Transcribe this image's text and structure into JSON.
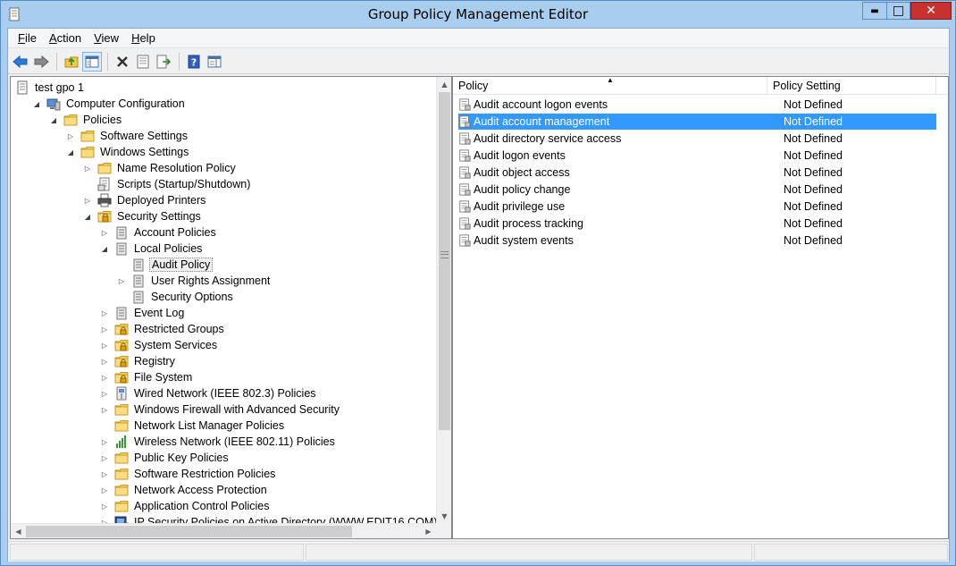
{
  "window": {
    "title": "Group Policy Management Editor",
    "minimize_glyph": "▬",
    "maximize_glyph": "□",
    "close_glyph": "✕"
  },
  "menu": {
    "items": [
      {
        "label": "File",
        "u": "F",
        "rest": "ile"
      },
      {
        "label": "Action",
        "u": "A",
        "rest": "ction"
      },
      {
        "label": "View",
        "u": "V",
        "rest": "iew"
      },
      {
        "label": "Help",
        "u": "H",
        "rest": "elp"
      }
    ]
  },
  "toolbar": {
    "buttons": [
      "back-icon",
      "forward-icon",
      "up-folder-icon",
      "show-hide-tree-icon",
      "delete-icon",
      "properties-icon",
      "export-list-icon",
      "help-icon",
      "show-hide-action-pane-icon"
    ]
  },
  "tree": {
    "items": [
      {
        "label": "test gpo 1",
        "indent": 0,
        "expander": "",
        "icon": "gpo-icon"
      },
      {
        "label": "Computer Configuration",
        "indent": 1,
        "expander": "open",
        "icon": "computer-icon"
      },
      {
        "label": "Policies",
        "indent": 2,
        "expander": "open",
        "icon": "folder-icon"
      },
      {
        "label": "Software Settings",
        "indent": 3,
        "expander": "closed",
        "icon": "folder-icon"
      },
      {
        "label": "Windows Settings",
        "indent": 3,
        "expander": "open",
        "icon": "folder-icon"
      },
      {
        "label": "Name Resolution Policy",
        "indent": 4,
        "expander": "closed",
        "icon": "folder-icon"
      },
      {
        "label": "Scripts (Startup/Shutdown)",
        "indent": 4,
        "expander": "",
        "icon": "script-icon"
      },
      {
        "label": "Deployed Printers",
        "indent": 4,
        "expander": "closed",
        "icon": "printer-icon"
      },
      {
        "label": "Security Settings",
        "indent": 4,
        "expander": "open",
        "icon": "security-icon"
      },
      {
        "label": "Account Policies",
        "indent": 5,
        "expander": "closed",
        "icon": "policy-book-icon"
      },
      {
        "label": "Local Policies",
        "indent": 5,
        "expander": "open",
        "icon": "policy-book-icon"
      },
      {
        "label": "Audit Policy",
        "indent": 6,
        "expander": "",
        "icon": "policy-book-icon",
        "selected": true
      },
      {
        "label": "User Rights Assignment",
        "indent": 6,
        "expander": "closed",
        "icon": "policy-book-icon"
      },
      {
        "label": "Security Options",
        "indent": 6,
        "expander": "",
        "icon": "policy-book-icon"
      },
      {
        "label": "Event Log",
        "indent": 5,
        "expander": "closed",
        "icon": "policy-book-icon"
      },
      {
        "label": "Restricted Groups",
        "indent": 5,
        "expander": "closed",
        "icon": "lock-folder-icon"
      },
      {
        "label": "System Services",
        "indent": 5,
        "expander": "closed",
        "icon": "lock-folder-icon"
      },
      {
        "label": "Registry",
        "indent": 5,
        "expander": "closed",
        "icon": "lock-folder-icon"
      },
      {
        "label": "File System",
        "indent": 5,
        "expander": "closed",
        "icon": "lock-folder-icon"
      },
      {
        "label": "Wired Network (IEEE 802.3) Policies",
        "indent": 5,
        "expander": "closed",
        "icon": "network-icon"
      },
      {
        "label": "Windows Firewall with Advanced Security",
        "indent": 5,
        "expander": "closed",
        "icon": "folder-icon"
      },
      {
        "label": "Network List Manager Policies",
        "indent": 5,
        "expander": "",
        "icon": "folder-icon"
      },
      {
        "label": "Wireless Network (IEEE 802.11) Policies",
        "indent": 5,
        "expander": "closed",
        "icon": "wireless-icon"
      },
      {
        "label": "Public Key Policies",
        "indent": 5,
        "expander": "closed",
        "icon": "folder-icon"
      },
      {
        "label": "Software Restriction Policies",
        "indent": 5,
        "expander": "closed",
        "icon": "folder-icon"
      },
      {
        "label": "Network Access Protection",
        "indent": 5,
        "expander": "closed",
        "icon": "folder-icon"
      },
      {
        "label": "Application Control Policies",
        "indent": 5,
        "expander": "closed",
        "icon": "folder-icon"
      },
      {
        "label": "IP Security Policies on Active Directory (WWW.EDIT16.COM)",
        "indent": 5,
        "expander": "closed",
        "icon": "ipsec-icon"
      }
    ]
  },
  "list": {
    "columns": [
      "Policy",
      "Policy Setting"
    ],
    "sort_glyph": "▲",
    "rows": [
      {
        "policy": "Audit account logon events",
        "setting": "Not Defined"
      },
      {
        "policy": "Audit account management",
        "setting": "Not Defined",
        "selected": true
      },
      {
        "policy": "Audit directory service access",
        "setting": "Not Defined"
      },
      {
        "policy": "Audit logon events",
        "setting": "Not Defined"
      },
      {
        "policy": "Audit object access",
        "setting": "Not Defined"
      },
      {
        "policy": "Audit policy change",
        "setting": "Not Defined"
      },
      {
        "policy": "Audit privilege use",
        "setting": "Not Defined"
      },
      {
        "policy": "Audit process tracking",
        "setting": "Not Defined"
      },
      {
        "policy": "Audit system events",
        "setting": "Not Defined"
      }
    ]
  },
  "colors": {
    "title_bar": "#a9cdee",
    "close_button": "#c7312f",
    "selection": "#3399ff"
  }
}
